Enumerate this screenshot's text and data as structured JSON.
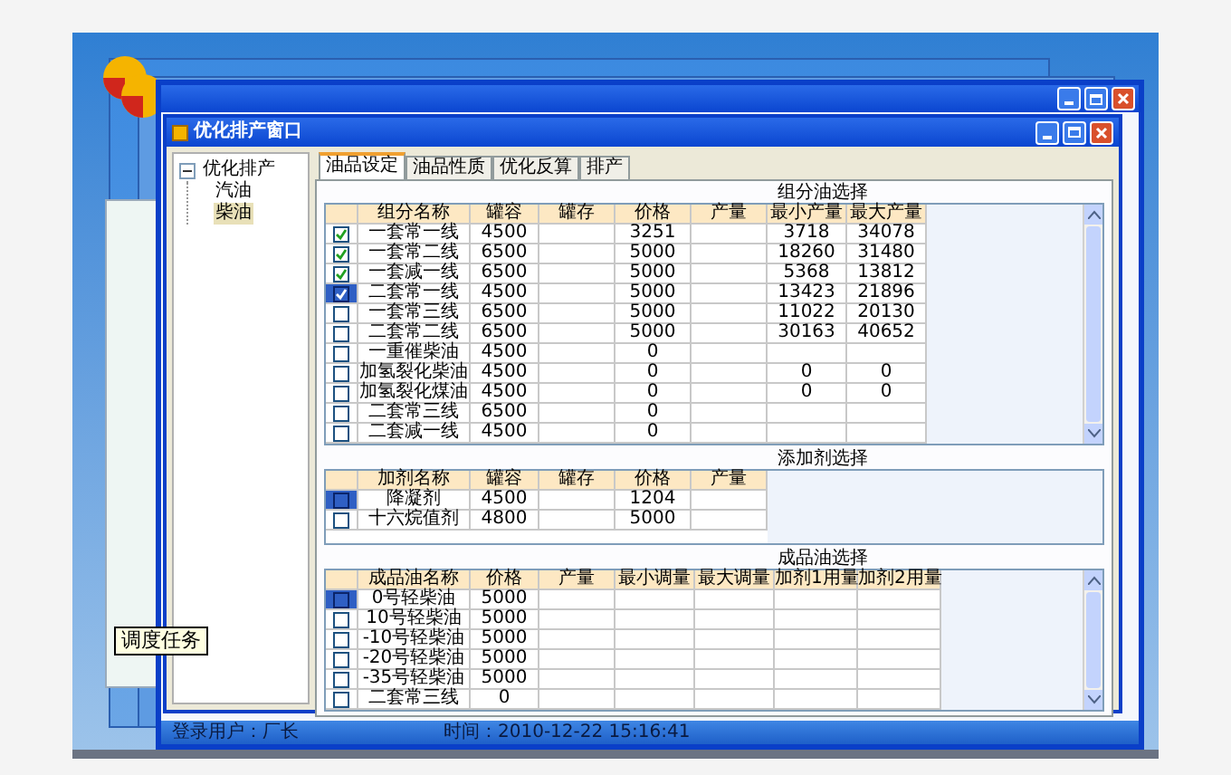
{
  "tooltip": "调度任务",
  "main_window": {
    "status_bar": {
      "user": "登录用户：厂长",
      "time": "时间：2010-12-22 15:16:41"
    }
  },
  "window": {
    "title": "优化排产窗口",
    "tree": [
      {
        "label": "优化排产",
        "expanded": true,
        "selected": false,
        "children": [
          {
            "label": "汽油",
            "selected": false
          },
          {
            "label": "柴油",
            "selected": true
          }
        ]
      }
    ],
    "tabs": [
      {
        "label": "油品设定",
        "selected": true
      },
      {
        "label": "油品性质",
        "selected": false
      },
      {
        "label": "优化反算",
        "selected": false
      },
      {
        "label": "排产",
        "selected": false
      }
    ],
    "sections": [
      {
        "title": "组分油选择",
        "columns": [
          "组分名称",
          "罐容",
          "罐存",
          "价格",
          "产量",
          "最小产量",
          "最大产量"
        ],
        "rows": [
          {
            "checked": true,
            "selected": false,
            "cells": [
              "一套常一线",
              "4500",
              null,
              "3251",
              null,
              "3718",
              "34078"
            ]
          },
          {
            "checked": true,
            "selected": false,
            "cells": [
              "一套常二线",
              "6500",
              null,
              "5000",
              null,
              "18260",
              "31480"
            ]
          },
          {
            "checked": true,
            "selected": false,
            "cells": [
              "一套减一线",
              "6500",
              null,
              "5000",
              null,
              "5368",
              "13812"
            ]
          },
          {
            "checked": true,
            "selected": true,
            "cells": [
              "二套常一线",
              "4500",
              null,
              "5000",
              null,
              "13423",
              "21896"
            ]
          },
          {
            "checked": false,
            "selected": false,
            "cells": [
              "一套常三线",
              "6500",
              null,
              "5000",
              null,
              "11022",
              "20130"
            ]
          },
          {
            "checked": false,
            "selected": false,
            "cells": [
              "二套常二线",
              "6500",
              null,
              "5000",
              null,
              "30163",
              "40652"
            ]
          },
          {
            "checked": false,
            "selected": false,
            "cells": [
              "一重催柴油",
              "4500",
              null,
              "0",
              null,
              null,
              null
            ]
          },
          {
            "checked": false,
            "selected": false,
            "cells": [
              "加氢裂化柴油",
              "4500",
              null,
              "0",
              null,
              "0",
              "0"
            ]
          },
          {
            "checked": false,
            "selected": false,
            "cells": [
              "加氢裂化煤油",
              "4500",
              null,
              "0",
              null,
              "0",
              "0"
            ]
          },
          {
            "checked": false,
            "selected": false,
            "cells": [
              "二套常三线",
              "6500",
              null,
              "0",
              null,
              null,
              null
            ]
          },
          {
            "checked": false,
            "selected": false,
            "cells": [
              "二套减一线",
              "4500",
              null,
              "0",
              null,
              null,
              null
            ]
          }
        ]
      },
      {
        "title": "添加剂选择",
        "columns": [
          "加剂名称",
          "罐容",
          "罐存",
          "价格",
          "产量"
        ],
        "rows": [
          {
            "checked": false,
            "selected": true,
            "cells": [
              "降凝剂",
              "4500",
              null,
              "1204",
              null
            ]
          },
          {
            "checked": false,
            "selected": false,
            "cells": [
              "十六烷值剂",
              "4800",
              null,
              "5000",
              null
            ]
          }
        ]
      },
      {
        "title": "成品油选择",
        "columns": [
          "成品油名称",
          "价格",
          "产量",
          "最小调量",
          "最大调量",
          "加剂1用量",
          "加剂2用量"
        ],
        "rows": [
          {
            "checked": false,
            "selected": true,
            "cells": [
              "0号轻柴油",
              "5000",
              null,
              null,
              null,
              null,
              null
            ]
          },
          {
            "checked": false,
            "selected": false,
            "cells": [
              "10号轻柴油",
              "5000",
              null,
              null,
              null,
              null,
              null
            ]
          },
          {
            "checked": false,
            "selected": false,
            "cells": [
              "-10号轻柴油",
              "5000",
              null,
              null,
              null,
              null,
              null
            ]
          },
          {
            "checked": false,
            "selected": false,
            "cells": [
              "-20号轻柴油",
              "5000",
              null,
              null,
              null,
              null,
              null
            ]
          },
          {
            "checked": false,
            "selected": false,
            "cells": [
              "-35号轻柴油",
              "5000",
              null,
              null,
              null,
              null,
              null
            ]
          },
          {
            "checked": false,
            "selected": false,
            "cells": [
              "二套常三线",
              "0",
              null,
              null,
              null,
              null,
              null
            ]
          }
        ]
      }
    ]
  }
}
